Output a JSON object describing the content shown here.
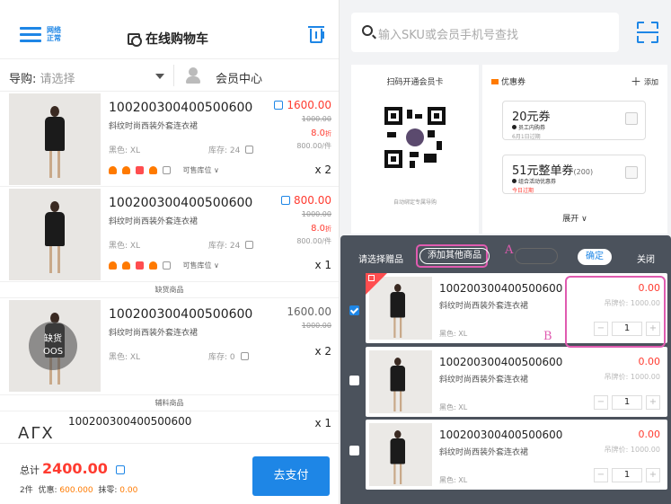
{
  "header": {
    "network_status": "网络正常",
    "cart_title": "在线购物车"
  },
  "guide": {
    "label": "导购:",
    "placeholder": "请选择",
    "member_center": "会员中心"
  },
  "cart_items": [
    {
      "sku": "100200300400500600",
      "name": "斜纹时尚西装外套连衣裙",
      "attr": "黑色: XL",
      "stock": "库存: 24",
      "price": "1600.00",
      "orig_price": "1000.00",
      "discount": "8.0",
      "discount_unit": "折",
      "unit_price": "800.00/件",
      "stock_pos": "可售库位 ∨",
      "qty": "x 2"
    },
    {
      "sku": "100200300400500600",
      "name": "斜纹时尚西装外套连衣裙",
      "attr": "黑色: XL",
      "stock": "库存: 24",
      "price": "800.00",
      "orig_price": "1000.00",
      "discount": "8.0",
      "discount_unit": "折",
      "unit_price": "800.00/件",
      "stock_pos": "可售库位 ∨",
      "qty": "x 1"
    }
  ],
  "oos_section": {
    "label": "缺货商品",
    "item": {
      "sku": "100200300400500600",
      "name": "斜纹时尚西装外套连衣裙",
      "attr": "黑色: XL",
      "stock": "库存: 0",
      "price": "1600.00",
      "orig_price": "1000.00",
      "qty": "x 2",
      "badge_cn": "缺货",
      "badge_en": "OOS"
    }
  },
  "aux_section": {
    "label": "辅料商品",
    "item": {
      "logo": "AΓX",
      "sku": "100200300400500600",
      "qty": "x 1"
    }
  },
  "footer": {
    "total_label": "总计",
    "total_value": "2400.00",
    "count": "2件",
    "discount_label": "优惠:",
    "discount_value": "600.000",
    "round_label": "抹零:",
    "round_value": "0.00",
    "pay_button": "去支付"
  },
  "search": {
    "placeholder": "输入SKU或会员手机号查找"
  },
  "member_card": {
    "title": "扫码开通会员卡",
    "hint": "自动绑定专属导购"
  },
  "coupons": {
    "title": "优惠券",
    "add_label": "添加",
    "items": [
      {
        "amount": "20元券",
        "extra": "",
        "desc": "员工内购券",
        "expiry": "6月1日过期",
        "expiry_red": false
      },
      {
        "amount": "51元整单券",
        "extra": "(200)",
        "desc": "组合活动优惠券",
        "expiry": "今日过期",
        "expiry_red": true
      }
    ],
    "expand": "展开 ∨"
  },
  "gift_panel": {
    "title": "请选择赠品",
    "add_other": "添加其他商品",
    "confirm": "确定",
    "close": "关闭",
    "annotation_a": "A",
    "annotation_b": "B",
    "items": [
      {
        "sku": "100200300400500600",
        "name": "斜纹时尚西装外套连衣裙",
        "attr": "黑色: XL",
        "price": "0.00",
        "tag_price": "吊牌价: 1000.00",
        "qty": "1",
        "checked": true
      },
      {
        "sku": "100200300400500600",
        "name": "斜纹时尚西装外套连衣裙",
        "attr": "黑色: XL",
        "price": "0.00",
        "tag_price": "吊牌价: 1000.00",
        "qty": "1",
        "checked": false
      },
      {
        "sku": "100200300400500600",
        "name": "斜纹时尚西装外套连衣裙",
        "attr": "黑色: XL",
        "price": "0.00",
        "tag_price": "吊牌价: 1000.00",
        "qty": "1",
        "checked": false
      }
    ]
  },
  "colors": {
    "accent": "#1e86e6",
    "price_red": "#ff3b30",
    "annotation": "#e05bb0",
    "overlay": "#4b525c"
  }
}
